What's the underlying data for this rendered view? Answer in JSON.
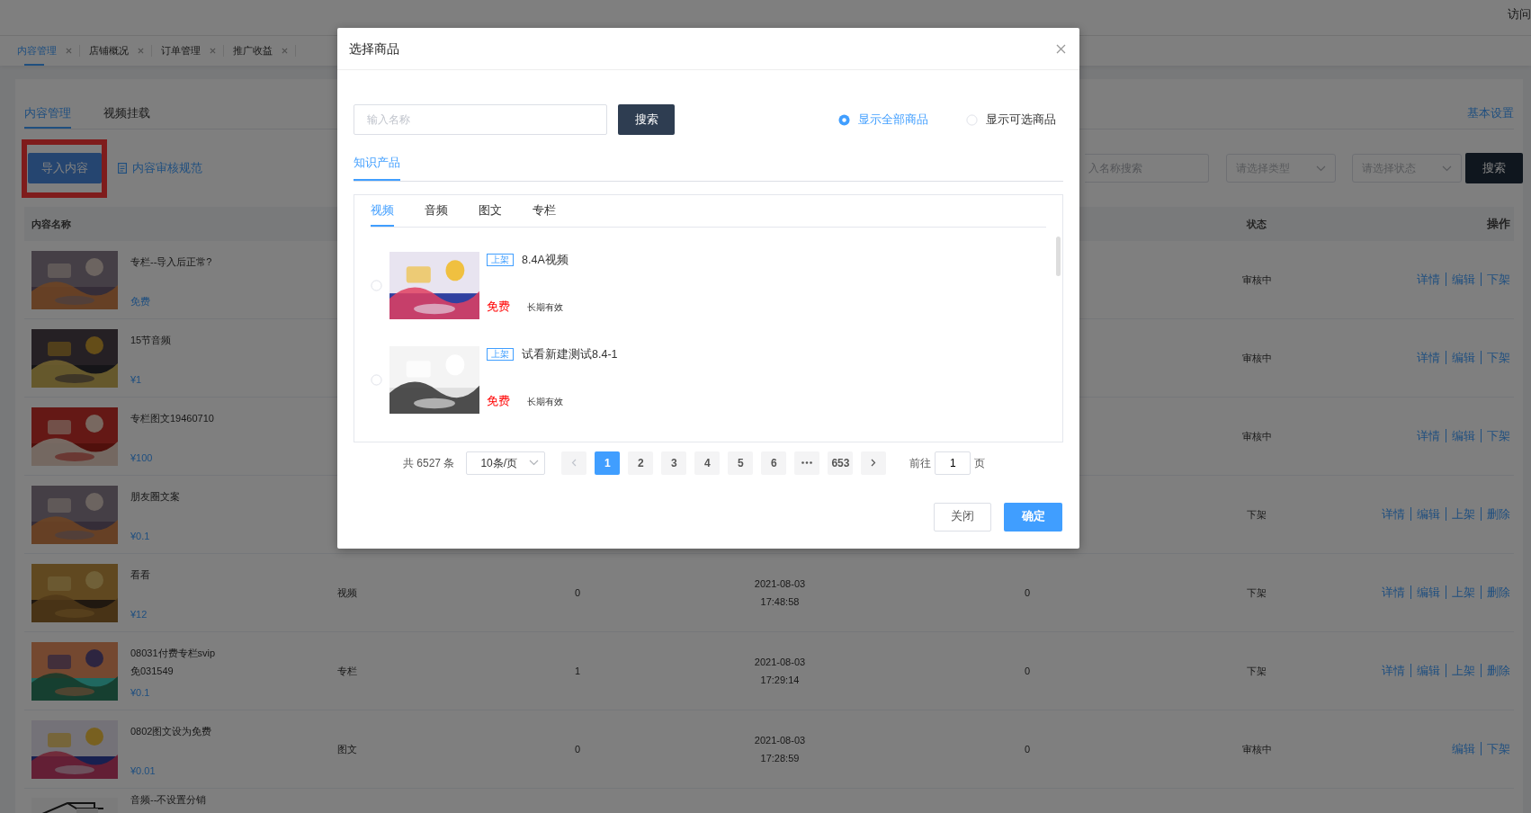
{
  "topbar": {
    "user_text": "访问"
  },
  "page_tabs": [
    {
      "label": "内容管理",
      "selected": true
    },
    {
      "label": "店铺概况",
      "selected": false
    },
    {
      "label": "订单管理",
      "selected": false
    },
    {
      "label": "推广收益",
      "selected": false
    }
  ],
  "content_tabs": [
    {
      "label": "内容管理",
      "selected": true
    },
    {
      "label": "视频挂载",
      "selected": false
    }
  ],
  "settings_link": "基本设置",
  "toolbar": {
    "import_button": "导入内容",
    "highlighted": true,
    "guidelines_link": "内容审核规范",
    "search_placeholder": "入名称搜索",
    "type_select": "请选择类型",
    "status_select": "请选择状态",
    "search_button": "搜索"
  },
  "table": {
    "columns": {
      "name": "内容名称",
      "status": "状态",
      "actions": "操作"
    },
    "rows": [
      {
        "name": "专栏--导入后正常?",
        "price": "免费",
        "status": "审核中",
        "actions": [
          "详情",
          "编辑",
          "下架"
        ]
      },
      {
        "name": "15节音频",
        "price": "¥1",
        "status": "审核中",
        "actions": [
          "详情",
          "编辑",
          "下架"
        ]
      },
      {
        "name": "专栏图文19460710",
        "price": "¥100",
        "status": "审核中",
        "actions": [
          "详情",
          "编辑",
          "下架"
        ]
      },
      {
        "name": "朋友圈文案",
        "price": "¥0.1",
        "status": "下架",
        "actions": [
          "详情",
          "编辑",
          "上架",
          "删除"
        ]
      },
      {
        "name": "看看",
        "price": "¥12",
        "type": "视频",
        "count": "0",
        "date": "2021-08-03",
        "time": "17:48:58",
        "column_5": "0",
        "status": "下架",
        "actions": [
          "详情",
          "编辑",
          "上架",
          "删除"
        ]
      },
      {
        "name": "08031付费专栏svip",
        "name_line2": "免031549",
        "price": "¥0.1",
        "type": "专栏",
        "count": "1",
        "date": "2021-08-03",
        "time": "17:29:14",
        "column_5": "0",
        "status": "下架",
        "actions": [
          "详情",
          "编辑",
          "上架",
          "删除"
        ]
      },
      {
        "name": "0802图文设为免费",
        "price": "¥0.01",
        "type": "图文",
        "count": "0",
        "date": "2021-08-03",
        "time": "17:28:59",
        "column_5": "0",
        "status": "审核中",
        "actions": [
          "编辑",
          "下架"
        ]
      },
      {
        "name": "音频--不设置分销"
      }
    ]
  },
  "dialog": {
    "title": "选择商品",
    "search_placeholder": "输入名称",
    "search_button": "搜索",
    "filters": [
      {
        "label": "显示全部商品",
        "selected": true
      },
      {
        "label": "显示可选商品",
        "selected": false
      }
    ],
    "category_tabs": [
      {
        "label": "知识产品",
        "selected": true
      }
    ],
    "type_tabs": [
      {
        "label": "视频",
        "selected": true
      },
      {
        "label": "音频",
        "selected": false
      },
      {
        "label": "图文",
        "selected": false
      },
      {
        "label": "专栏",
        "selected": false
      }
    ],
    "items": [
      {
        "badge": "上架",
        "title": "8.4A视频",
        "price": "免费",
        "validity": "长期有效",
        "selected": false
      },
      {
        "badge": "上架",
        "title": "试看新建测试8.4-1",
        "price": "免费",
        "validity": "长期有效",
        "selected": false
      }
    ],
    "pagination": {
      "total": "共 6527 条",
      "page_size": "10条/页",
      "pages": [
        {
          "kind": "page",
          "label": "1",
          "selected": true
        },
        {
          "kind": "page",
          "label": "2",
          "selected": false
        },
        {
          "kind": "page",
          "label": "3",
          "selected": false
        },
        {
          "kind": "page",
          "label": "4",
          "selected": false
        },
        {
          "kind": "page",
          "label": "5",
          "selected": false
        },
        {
          "kind": "page",
          "label": "6",
          "selected": false
        },
        {
          "kind": "more"
        },
        {
          "kind": "page",
          "label": "653",
          "selected": false
        }
      ],
      "goto_label": "前往",
      "goto_value": "1",
      "page_unit": "页"
    },
    "close_button": "关闭",
    "confirm_button": "确定"
  }
}
